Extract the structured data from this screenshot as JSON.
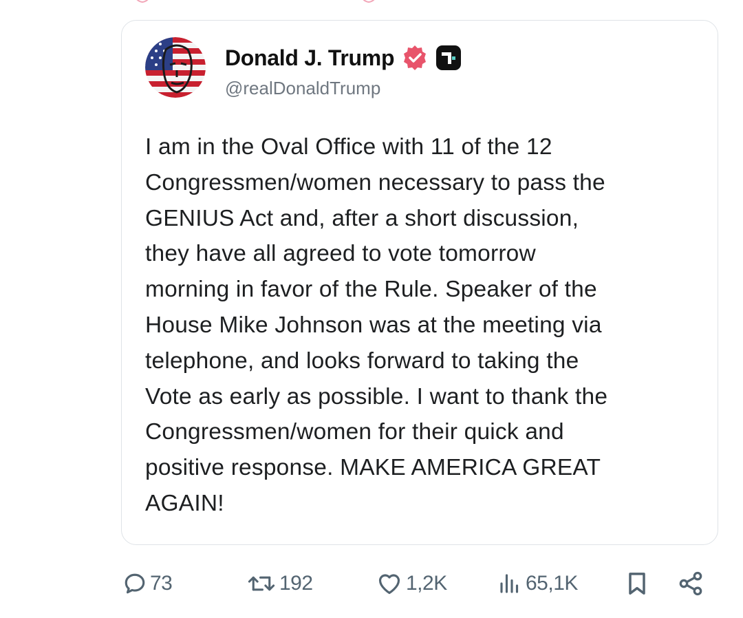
{
  "colors": {
    "verified_badge": "#e8546b",
    "action_gray": "#536471",
    "text": "#1d1f21",
    "handle_gray": "#6f7780",
    "card_border": "#dfe3e7"
  },
  "post": {
    "author": {
      "display_name": "Donald J. Trump",
      "handle": "@realDonaldTrump",
      "verified_icon": "verified-badge-icon",
      "platform_icon": "truth-social-icon"
    },
    "text": "I am in the Oval Office with 11 of the 12\nCongressmen/women necessary to pass the\nGENIUS Act and, after a short discussion,\nthey have all agreed to vote tomorrow\nmorning in favor of the Rule. Speaker of the\nHouse Mike Johnson was at the meeting via\ntelephone, and looks forward to taking the\nVote as early as possible. I want to thank the\nCongressmen/women for their quick and\npositive response. MAKE AMERICA GREAT\nAGAIN!"
  },
  "actions": {
    "replies": {
      "icon": "reply-icon",
      "count": "73"
    },
    "reposts": {
      "icon": "repost-icon",
      "count": "192"
    },
    "likes": {
      "icon": "heart-icon",
      "count": "1,2K"
    },
    "views": {
      "icon": "views-chart-icon",
      "count": "65,1K"
    },
    "bookmark": {
      "icon": "bookmark-icon"
    },
    "share": {
      "icon": "share-icon"
    }
  }
}
